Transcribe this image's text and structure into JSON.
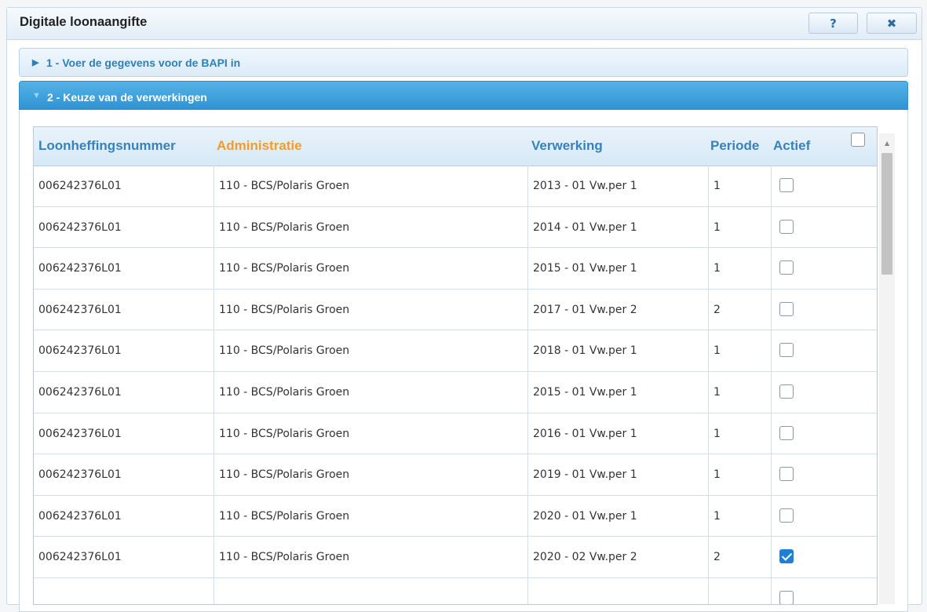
{
  "dialog": {
    "title": "Digitale loonaangifte",
    "help_label": "?",
    "close_label": "✖"
  },
  "accordion": {
    "step1": {
      "arrow": "▶",
      "label": "1 - Voer de gegevens voor de BAPI in"
    },
    "step2": {
      "arrow": "▼",
      "label": "2 - Keuze van de verwerkingen"
    }
  },
  "grid": {
    "columns": [
      "Loonheffingsnummer",
      "Administratie",
      "Verwerking",
      "Periode",
      "Actief"
    ],
    "sorted_column": "Administratie",
    "select_all_checked": false,
    "rows": [
      {
        "loonheffingsnummer": "006242376L01",
        "administratie": "110 - BCS/Polaris Groen",
        "verwerking": "2013 - 01 Vw.per 1",
        "periode": "1",
        "actief": false
      },
      {
        "loonheffingsnummer": "006242376L01",
        "administratie": "110 - BCS/Polaris Groen",
        "verwerking": "2014 - 01 Vw.per 1",
        "periode": "1",
        "actief": false
      },
      {
        "loonheffingsnummer": "006242376L01",
        "administratie": "110 - BCS/Polaris Groen",
        "verwerking": "2015 - 01 Vw.per 1",
        "periode": "1",
        "actief": false
      },
      {
        "loonheffingsnummer": "006242376L01",
        "administratie": "110 - BCS/Polaris Groen",
        "verwerking": "2017 - 01 Vw.per 2",
        "periode": "2",
        "actief": false
      },
      {
        "loonheffingsnummer": "006242376L01",
        "administratie": "110 - BCS/Polaris Groen",
        "verwerking": "2018 - 01 Vw.per 1",
        "periode": "1",
        "actief": false
      },
      {
        "loonheffingsnummer": "006242376L01",
        "administratie": "110 - BCS/Polaris Groen",
        "verwerking": "2015 - 01 Vw.per 1",
        "periode": "1",
        "actief": false
      },
      {
        "loonheffingsnummer": "006242376L01",
        "administratie": "110 - BCS/Polaris Groen",
        "verwerking": "2016 - 01 Vw.per 1",
        "periode": "1",
        "actief": false
      },
      {
        "loonheffingsnummer": "006242376L01",
        "administratie": "110 - BCS/Polaris Groen",
        "verwerking": "2019 - 01 Vw.per 1",
        "periode": "1",
        "actief": false
      },
      {
        "loonheffingsnummer": "006242376L01",
        "administratie": "110 - BCS/Polaris Groen",
        "verwerking": "2020 - 01 Vw.per 1",
        "periode": "1",
        "actief": false
      },
      {
        "loonheffingsnummer": "006242376L01",
        "administratie": "110 - BCS/Polaris Groen",
        "verwerking": "2020 - 02 Vw.per 2",
        "periode": "2",
        "actief": true
      },
      {
        "loonheffingsnummer": "",
        "administratie": "",
        "verwerking": "",
        "periode": "",
        "actief": false
      }
    ]
  },
  "scrollbar": {
    "up_arrow": "▲"
  },
  "colors": {
    "accent_blue": "#2f93d3",
    "header_text": "#3682bb",
    "sorted_header": "#f29c2c",
    "checkbox_checked": "#1f7fd6"
  }
}
